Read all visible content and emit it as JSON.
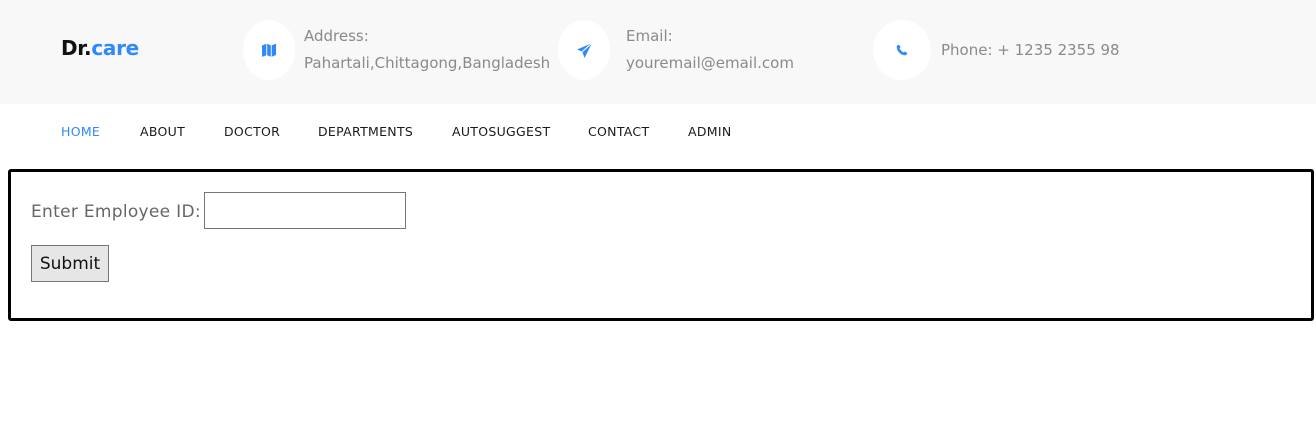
{
  "header": {
    "logo_part1": "Dr.",
    "logo_part2": "care",
    "address": {
      "label": "Address:",
      "value": "Pahartali,Chittagong,Bangladesh",
      "icon": "map-icon"
    },
    "email": {
      "label": "Email:",
      "value": "youremail@email.com",
      "icon": "paper-plane-icon"
    },
    "phone": {
      "text": "Phone: + 1235 2355 98",
      "icon": "phone-icon"
    }
  },
  "nav": {
    "items": [
      {
        "label": "HOME",
        "active": true
      },
      {
        "label": "ABOUT"
      },
      {
        "label": "DOCTOR"
      },
      {
        "label": "DEPARTMENTS"
      },
      {
        "label": "AUTOSUGGEST"
      },
      {
        "label": "CONTACT"
      },
      {
        "label": "ADMIN"
      }
    ]
  },
  "form": {
    "label": "Enter Employee ID:",
    "input_value": "",
    "submit_label": "Submit"
  },
  "colors": {
    "accent": "#2f89fc",
    "topbar_bg": "#f8f8f8",
    "muted_text": "#8a8a8a"
  }
}
